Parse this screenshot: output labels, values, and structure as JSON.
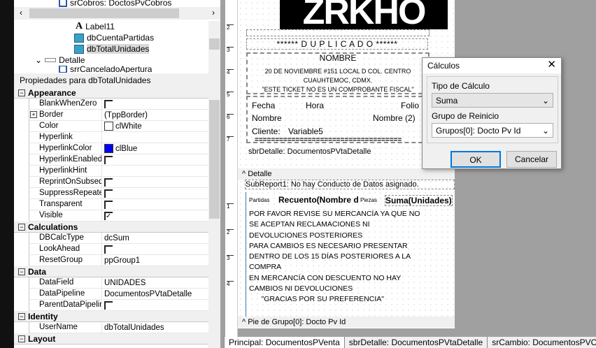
{
  "tree": {
    "top_item": "srCobros: DoctosPvCobros",
    "items": [
      {
        "label": "Label11",
        "icon": "label-icon"
      },
      {
        "label": "dbCuentaPartidas",
        "icon": "dbcalc-icon"
      },
      {
        "label": "dbTotalUnidades",
        "icon": "dbcalc-icon",
        "selected": true
      },
      {
        "label": "Detalle",
        "icon": "band-icon"
      },
      {
        "label": "srrCanceladoApertura",
        "icon": "subreport-icon"
      }
    ]
  },
  "props": {
    "header": "Propiedades para dbTotalUnidades",
    "categories": [
      {
        "name": "Appearance",
        "rows": [
          {
            "name": "BlankWhenZero",
            "type": "check",
            "checked": false
          },
          {
            "name": "Border",
            "value": "(TppBorder)",
            "expand": true
          },
          {
            "name": "Color",
            "value": "clWhite",
            "swatch": "#ffffff"
          },
          {
            "name": "Hyperlink",
            "value": ""
          },
          {
            "name": "HyperlinkColor",
            "value": "clBlue",
            "swatch": "#0000ff"
          },
          {
            "name": "HyperlinkEnabled",
            "type": "check",
            "checked": false
          },
          {
            "name": "HyperlinkHint",
            "value": ""
          },
          {
            "name": "ReprintOnSubsequ",
            "type": "check",
            "checked": false
          },
          {
            "name": "SuppressRepeatec",
            "type": "check",
            "checked": false
          },
          {
            "name": "Transparent",
            "type": "check",
            "checked": false
          },
          {
            "name": "Visible",
            "type": "check",
            "checked": true
          }
        ]
      },
      {
        "name": "Calculations",
        "rows": [
          {
            "name": "DBCalcType",
            "value": "dcSum"
          },
          {
            "name": "LookAhead",
            "type": "check",
            "checked": false
          },
          {
            "name": "ResetGroup",
            "value": "ppGroup1"
          }
        ]
      },
      {
        "name": "Data",
        "rows": [
          {
            "name": "DataField",
            "value": "UNIDADES"
          },
          {
            "name": "DataPipeline",
            "value": "DocumentosPVtaDetalle"
          },
          {
            "name": "ParentDataPipeline",
            "type": "check",
            "checked": false
          }
        ]
      },
      {
        "name": "Identity",
        "rows": [
          {
            "name": "UserName",
            "value": "dbTotalUnidades"
          }
        ]
      },
      {
        "name": "Layout",
        "rows": []
      }
    ]
  },
  "report": {
    "logo": "ZRKHO",
    "duplicado": "****** D U P L I C A D O ******",
    "nombre": "NOMBRE",
    "address1": "20 DE NOVIEMBRE #151 LOCAL D COL. CENTRO",
    "address2": "CUAUHTEMOC, CDMX.",
    "fiscal": "\"ESTE TICKET NO ES UN COMPROBANTE FISCAL\"",
    "fecha": "Fecha",
    "hora": "Hora",
    "folio": "Folio",
    "nombre_lbl": "Nombre",
    "nombre2": "Nombre (2)",
    "cliente": "Cliente:",
    "variable5": "Variable5",
    "separator": "====================================",
    "sbr_detalle": "sbrDetalle: DocumentosPVtaDetalle",
    "band_detalle": "Detalle",
    "subreport1": "SubReport1: No hay Conducto de Datos asignado.",
    "partidas": "Partidas",
    "recuento": "Recuento(Nombre d",
    "piezas": "Piezas",
    "suma": "Suma(Unidades)",
    "footer_lines": [
      "POR FAVOR REVISE SU MERCANCÍA YA QUE NO",
      "SE ACEPTAN RECLAMACIONES NI",
      "DEVOLUCIONES POSTERIORES",
      "PARA CAMBIOS ES NECESARIO PRESENTAR",
      "DENTRO DE LOS 15 DÍAS POSTERIORES A LA",
      "COMPRA",
      "EN MERCANCÍA CON DESCUENTO NO HAY",
      "CAMBIOS NI DEVOLUCIONES",
      "      \"GRACIAS POR SU PREFERENCIA\""
    ],
    "band_pie": "Pie de Grupo[0]: Docto Pv Id",
    "ruler_top": [
      "2",
      "3",
      "4",
      "5",
      "6",
      "7"
    ],
    "ruler_bottom": [
      "1",
      "2",
      "3",
      "4"
    ]
  },
  "dialog": {
    "title": "Cálculos",
    "tipo_label": "Tipo de Cálculo",
    "tipo_value": "Suma",
    "grupo_label": "Grupo de Reinicio",
    "grupo_value": "Grupos[0]: Docto Pv Id",
    "ok": "OK",
    "cancel": "Cancelar"
  },
  "tabs": [
    "Principal: DocumentosPVenta",
    "sbrDetalle: DocumentosPVtaDetalle",
    "srCambio: DocumentosPVC"
  ]
}
